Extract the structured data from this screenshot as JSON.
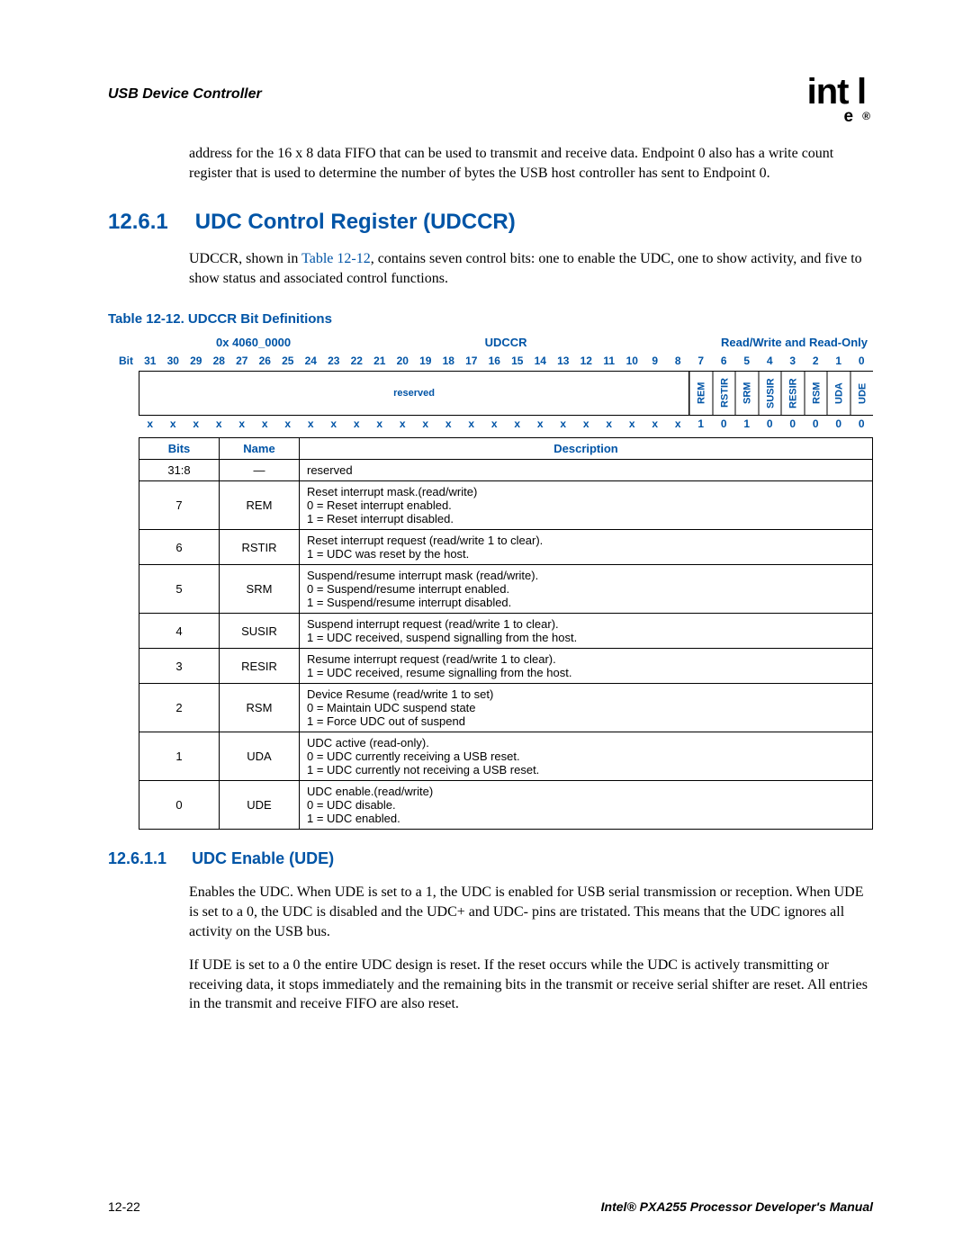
{
  "header": {
    "left": "USB Device Controller",
    "logo_main": "int",
    "logo_sub": "e",
    "logo_end": "l",
    "logo_reg": "®"
  },
  "intro_para": "address for the 16 x 8 data FIFO that can be used to transmit and receive data. Endpoint 0 also has a write count register that is used to determine the number of bytes the USB host controller has sent to Endpoint 0.",
  "section": {
    "num": "12.6.1",
    "title": "UDC Control Register (UDCCR)"
  },
  "section_para_pre": "UDCCR, shown in ",
  "section_para_xref": "Table 12-12",
  "section_para_post": ", contains seven control bits: one to enable the UDC, one to show activity, and five to show status and associated control functions.",
  "table_caption": "Table 12-12. UDCCR Bit Definitions",
  "reg_top": {
    "addr": "0x 4060_0000",
    "name": "UDCCR",
    "access": "Read/Write and Read-Only"
  },
  "bit_label": "Bit",
  "bit_numbers": [
    "31",
    "30",
    "29",
    "28",
    "27",
    "26",
    "25",
    "24",
    "23",
    "22",
    "21",
    "20",
    "19",
    "18",
    "17",
    "16",
    "15",
    "14",
    "13",
    "12",
    "11",
    "10",
    "9",
    "8",
    "7",
    "6",
    "5",
    "4",
    "3",
    "2",
    "1",
    "0"
  ],
  "fields": {
    "reserved": "reserved",
    "f7": "REM",
    "f6": "RSTIR",
    "f5": "SRM",
    "f4": "SUSIR",
    "f3": "RESIR",
    "f2": "RSM",
    "f1": "UDA",
    "f0": "UDE"
  },
  "reset_values": [
    "x",
    "x",
    "x",
    "x",
    "x",
    "x",
    "x",
    "x",
    "x",
    "x",
    "x",
    "x",
    "x",
    "x",
    "x",
    "x",
    "x",
    "x",
    "x",
    "x",
    "x",
    "x",
    "x",
    "x",
    "1",
    "0",
    "1",
    "0",
    "0",
    "0",
    "0",
    "0"
  ],
  "def_headers": {
    "bits": "Bits",
    "name": "Name",
    "desc": "Description"
  },
  "defs": [
    {
      "bits": "31:8",
      "name": "—",
      "desc": "reserved"
    },
    {
      "bits": "7",
      "name": "REM",
      "desc": "Reset interrupt mask.(read/write)\n0 =  Reset interrupt enabled.\n1 =  Reset interrupt disabled."
    },
    {
      "bits": "6",
      "name": "RSTIR",
      "desc": "Reset interrupt request (read/write 1 to clear).\n1 =  UDC was reset by the host."
    },
    {
      "bits": "5",
      "name": "SRM",
      "desc": "Suspend/resume interrupt mask (read/write).\n0 =  Suspend/resume interrupt enabled.\n1 =  Suspend/resume interrupt disabled."
    },
    {
      "bits": "4",
      "name": "SUSIR",
      "desc": "Suspend interrupt request (read/write 1 to clear).\n1 =  UDC received, suspend signalling from the host."
    },
    {
      "bits": "3",
      "name": "RESIR",
      "desc": "Resume interrupt request (read/write 1 to clear).\n1 =  UDC received, resume signalling from the host."
    },
    {
      "bits": "2",
      "name": "RSM",
      "desc": "Device Resume (read/write 1 to set)\n0 =  Maintain UDC suspend state\n1 =  Force UDC out of suspend"
    },
    {
      "bits": "1",
      "name": "UDA",
      "desc": "UDC active (read-only).\n0 =  UDC currently receiving a USB reset.\n1 =  UDC currently not receiving a USB reset."
    },
    {
      "bits": "0",
      "name": "UDE",
      "desc": "UDC enable.(read/write)\n0 =  UDC disable.\n1 =  UDC enabled."
    }
  ],
  "sub_section": {
    "num": "12.6.1.1",
    "title": "UDC Enable (UDE)"
  },
  "sub_para1": "Enables the UDC. When UDE is set to a 1, the UDC is enabled for USB serial transmission or reception. When UDE is set to a 0, the UDC is disabled and the UDC+ and UDC- pins are tristated. This means that the UDC ignores all activity on the USB bus.",
  "sub_para2": "If UDE is set to a 0 the entire UDC design is reset. If the reset occurs while the UDC is actively transmitting or receiving data, it stops immediately and the remaining bits in the transmit or receive serial shifter are reset. All entries in the transmit and receive FIFO are also reset.",
  "footer": {
    "left": "12-22",
    "right": "Intel® PXA255 Processor Developer's Manual"
  }
}
